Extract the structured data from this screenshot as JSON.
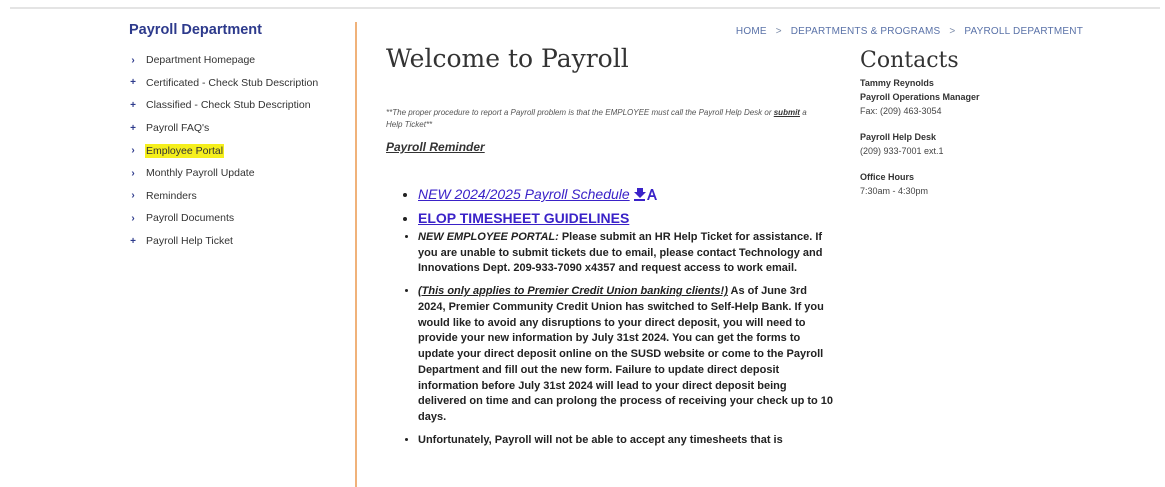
{
  "sidebar": {
    "title": "Payroll Department",
    "items": [
      {
        "marker": "›",
        "label": "Department Homepage"
      },
      {
        "marker": "+",
        "label": "Certificated - Check Stub Description"
      },
      {
        "marker": "+",
        "label": "Classified - Check Stub Description"
      },
      {
        "marker": "+",
        "label": "Payroll FAQ's"
      },
      {
        "marker": "›",
        "label": "Employee Portal",
        "active": true
      },
      {
        "marker": "›",
        "label": "Monthly Payroll Update"
      },
      {
        "marker": "›",
        "label": "Reminders"
      },
      {
        "marker": "›",
        "label": "Payroll Documents"
      },
      {
        "marker": "+",
        "label": "Payroll Help Ticket"
      }
    ]
  },
  "breadcrumb": {
    "items": [
      "HOME",
      "DEPARTMENTS & PROGRAMS",
      "PAYROLL DEPARTMENT"
    ],
    "separator": ">"
  },
  "main": {
    "title": "Welcome to Payroll",
    "notice_pre": "**The proper procedure to report a Payroll problem is that the EMPLOYEE must call the Payroll Help Desk or ",
    "notice_link": "submit",
    "notice_post": " a Help Ticket**",
    "reminder_heading": "Payroll Reminder",
    "link1": "NEW 2024/2025 Payroll Schedule",
    "link2": "ELOP TIMESHEET GUIDELINES",
    "item3_label": "NEW EMPLOYEE PORTAL:",
    "item3_text": " Please submit an HR Help Ticket for assistance. If you are unable to submit tickets due to email, please contact Technology and Innovations Dept. 209-933-7090 x4357 and request access to work email.",
    "item4_label": "(This only applies to Premier Credit Union banking clients!)",
    "item4_text": " As of June 3rd 2024, Premier Community Credit Union has switched to Self-Help Bank. If you would like to avoid any disruptions to your direct deposit, you will need to provide your new information by July 31st 2024. You can get the forms to update your direct deposit online on the SUSD website or come to the Payroll Department and fill out the new form. Failure to update direct deposit information before July 31st 2024 will lead to your direct deposit being delivered on time and can prolong the process of receiving your check up to 10 days.",
    "item5_text": "Unfortunately, Payroll will not be able to accept any timesheets that is"
  },
  "contacts": {
    "title": "Contacts",
    "person_name": "Tammy Reynolds",
    "person_role": "Payroll Operations Manager",
    "person_fax": "Fax: (209) 463-3054",
    "helpdesk_label": "Payroll Help Desk",
    "helpdesk_phone": "(209) 933-7001 ext.1",
    "hours_label": "Office Hours",
    "hours_value": "7:30am - 4:30pm"
  },
  "colors": {
    "accent": "#2d3a8c",
    "highlight": "#f5ef1c",
    "divider": "#f0b27a",
    "link": "#3a22c8"
  }
}
